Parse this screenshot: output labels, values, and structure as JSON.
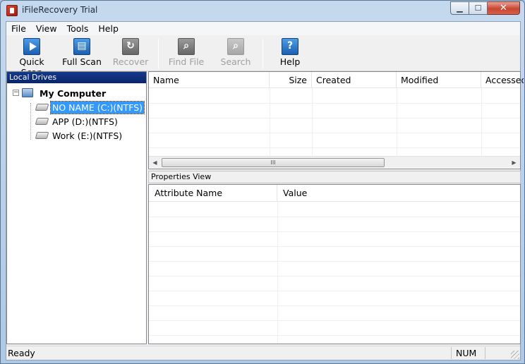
{
  "window": {
    "title": "iFileRecovery Trial"
  },
  "menu": [
    "File",
    "View",
    "Tools",
    "Help"
  ],
  "toolbar": {
    "quick_scan": "Quick Scan",
    "full_scan": "Full Scan",
    "recover": "Recover",
    "find_file": "Find File",
    "search": "Search",
    "help": "Help"
  },
  "left_pane": {
    "header": "Local Drives",
    "root": "My Computer",
    "drives": [
      "NO NAME (C:)(NTFS)",
      "APP (D:)(NTFS)",
      "Work (E:)(NTFS)"
    ],
    "selected_index": 0
  },
  "file_list": {
    "columns": [
      "Name",
      "Size",
      "Created",
      "Modified",
      "Accessed"
    ],
    "scroll_grip": "III"
  },
  "properties": {
    "header": "Properties View",
    "columns": [
      "Attribute Name",
      "Value"
    ]
  },
  "status": {
    "text": "Ready",
    "num": "NUM"
  },
  "colors": {
    "selection": "#3399ff",
    "pane_header": "#0a246a"
  }
}
